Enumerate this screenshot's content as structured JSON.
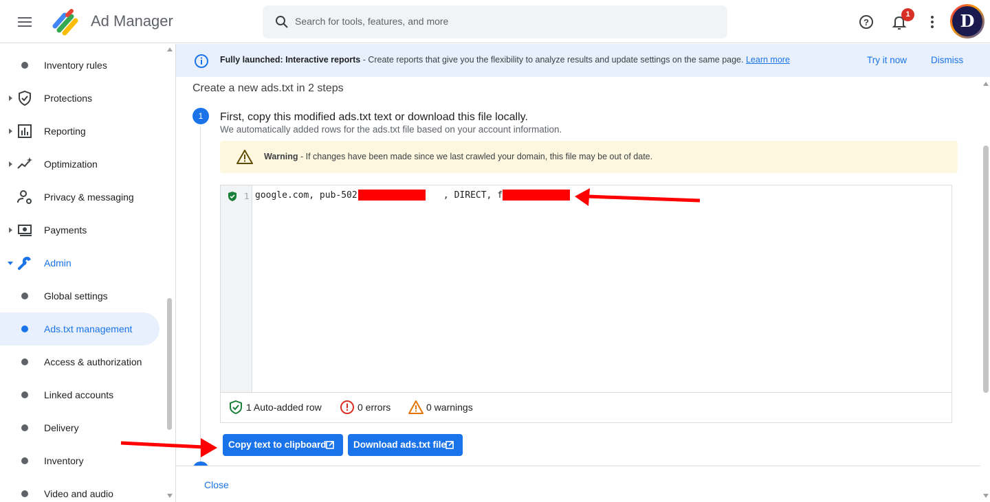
{
  "header": {
    "app_title": "Ad Manager",
    "search_placeholder": "Search for tools, features, and more",
    "notification_count": "1",
    "avatar_letter": "D"
  },
  "sidebar": {
    "items": [
      {
        "label": "Inventory rules",
        "icon": "dot"
      },
      {
        "label": "Protections",
        "icon": "shield-icon"
      },
      {
        "label": "Reporting",
        "icon": "bar-chart-icon"
      },
      {
        "label": "Optimization",
        "icon": "sparkle-trend-icon"
      },
      {
        "label": "Privacy & messaging",
        "icon": "person-settings-icon"
      },
      {
        "label": "Payments",
        "icon": "money-icon"
      },
      {
        "label": "Admin",
        "icon": "wrench-icon"
      },
      {
        "label": "Global settings",
        "icon": "dot"
      },
      {
        "label": "Ads.txt management",
        "icon": "dot"
      },
      {
        "label": "Access & authorization",
        "icon": "dot"
      },
      {
        "label": "Linked accounts",
        "icon": "dot"
      },
      {
        "label": "Delivery",
        "icon": "dot"
      },
      {
        "label": "Inventory",
        "icon": "dot"
      },
      {
        "label": "Video and audio",
        "icon": "dot"
      }
    ]
  },
  "banner": {
    "bold": "Fully launched: Interactive reports",
    "text": " - Create reports that give you the flexibility to analyze results and update settings on the same page. ",
    "link": "Learn more",
    "try_label": "Try it now",
    "dismiss_label": "Dismiss"
  },
  "main": {
    "title": "Create a new ads.txt in 2 steps",
    "step1": {
      "number": "1",
      "title": "First, copy this modified ads.txt text or download this file locally.",
      "subtitle": "We automatically added rows for the ads.txt file based on your account information."
    },
    "warning": {
      "bold": "Warning",
      "text": " - If changes have been made since we last crawled your domain, this file may be out of date."
    },
    "editor": {
      "line_number": "1",
      "code": "google.com, pub-502                , DIRECT, f08c4"
    },
    "stats": {
      "auto_added": "1 Auto-added row",
      "errors": "0 errors",
      "warnings": "0 warnings"
    },
    "buttons": {
      "copy": "Copy text to clipboard",
      "download": "Download ads.txt file"
    }
  },
  "footer": {
    "close_label": "Close"
  },
  "colors": {
    "accent": "#1a73e8",
    "banner_bg": "#e8f0fe",
    "warning_bg": "#fef7e0",
    "annotation_arrow": "#ff0000"
  }
}
